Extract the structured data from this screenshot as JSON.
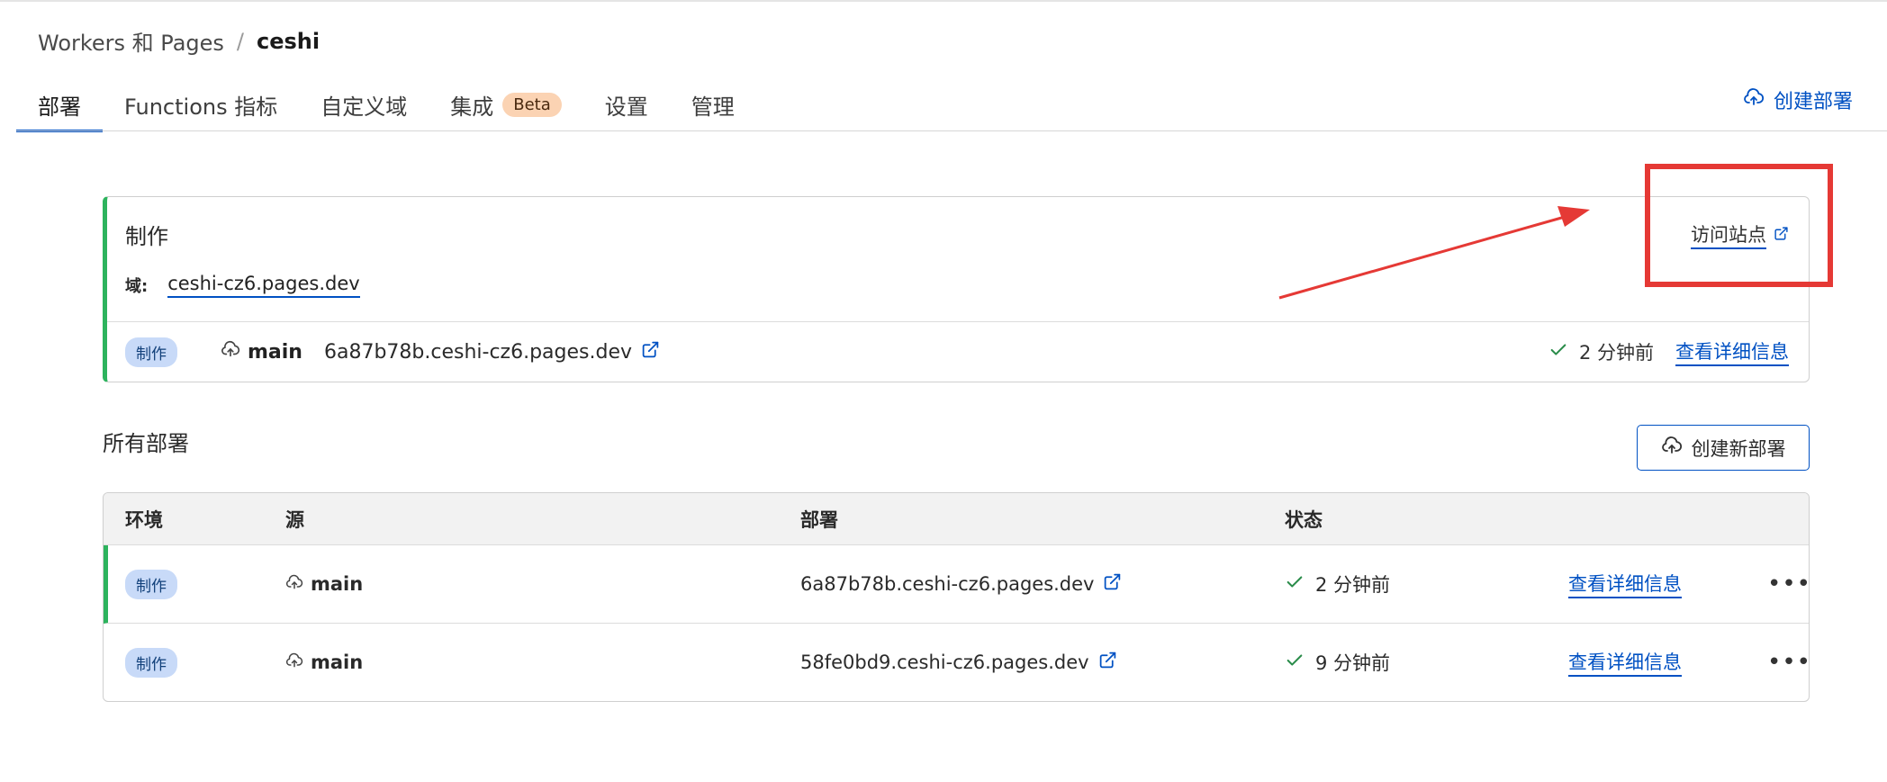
{
  "breadcrumb": {
    "parent": "Workers 和 Pages",
    "separator": "/",
    "current": "ceshi"
  },
  "tabs": [
    {
      "label": "部署",
      "active": true
    },
    {
      "label": "Functions 指标"
    },
    {
      "label": "自定义域"
    },
    {
      "label": "集成",
      "badge": "Beta"
    },
    {
      "label": "设置"
    },
    {
      "label": "管理"
    }
  ],
  "header_action": {
    "label": "创建部署",
    "icon": "cloud-upload-icon"
  },
  "production": {
    "title": "制作",
    "domain_label": "域:",
    "domain": "ceshi-cz6.pages.dev",
    "visit_label": "访问站点",
    "badge": "制作",
    "branch": "main",
    "deployment_url": "6a87b78b.ceshi-cz6.pages.dev",
    "time": "2 分钟前",
    "details_label": "查看详细信息"
  },
  "all_deployments": {
    "title": "所有部署",
    "create_button": "创建新部署",
    "columns": [
      "环境",
      "源",
      "部署",
      "状态"
    ],
    "rows": [
      {
        "env": "制作",
        "branch": "main",
        "url": "6a87b78b.ceshi-cz6.pages.dev",
        "time": "2 分钟前",
        "details": "查看详细信息",
        "more": "•••"
      },
      {
        "env": "制作",
        "branch": "main",
        "url": "58fe0bd9.ceshi-cz6.pages.dev",
        "time": "9 分钟前",
        "details": "查看详细信息",
        "more": "•••"
      }
    ]
  },
  "colors": {
    "accent": "#0051c3",
    "success": "#2db35d",
    "annotation": "#e53935",
    "badge_bg": "#c8daf8",
    "beta_bg": "#fbd3b3"
  }
}
